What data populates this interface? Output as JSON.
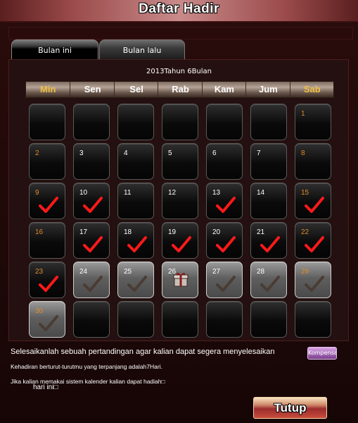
{
  "window": {
    "title": "Daftar Hadir"
  },
  "tabs": [
    {
      "label": "Bulan ini",
      "active": true
    },
    {
      "label": "Bulan lalu",
      "active": false
    }
  ],
  "calendar": {
    "month_label": "2013Tahun 6Bulan",
    "weekdays": [
      "Min",
      "Sen",
      "Sel",
      "Rab",
      "Kam",
      "Jum",
      "Sab"
    ],
    "weekday_colors": [
      "#f0c040",
      "#ffffff",
      "#ffffff",
      "#ffffff",
      "#ffffff",
      "#ffffff",
      "#f0c040"
    ],
    "weekend_number_color": "#e08a2a",
    "check_colors": {
      "attended": "#ff1a1a",
      "pending": "#4a3c34"
    },
    "rows": [
      [
        null,
        null,
        null,
        null,
        null,
        null,
        {
          "day": "1",
          "state": "empty"
        }
      ],
      [
        {
          "day": "2",
          "state": "empty"
        },
        {
          "day": "3",
          "state": "empty"
        },
        {
          "day": "4",
          "state": "empty"
        },
        {
          "day": "5",
          "state": "empty"
        },
        {
          "day": "6",
          "state": "empty"
        },
        {
          "day": "7",
          "state": "empty"
        },
        {
          "day": "8",
          "state": "empty"
        }
      ],
      [
        {
          "day": "9",
          "state": "checked"
        },
        {
          "day": "10",
          "state": "checked"
        },
        {
          "day": "11",
          "state": "empty"
        },
        {
          "day": "12",
          "state": "empty"
        },
        {
          "day": "13",
          "state": "checked"
        },
        {
          "day": "14",
          "state": "empty"
        },
        {
          "day": "15",
          "state": "checked"
        }
      ],
      [
        {
          "day": "16",
          "state": "empty"
        },
        {
          "day": "17",
          "state": "checked"
        },
        {
          "day": "18",
          "state": "checked"
        },
        {
          "day": "19",
          "state": "checked"
        },
        {
          "day": "20",
          "state": "checked"
        },
        {
          "day": "21",
          "state": "checked"
        },
        {
          "day": "22",
          "state": "checked"
        }
      ],
      [
        {
          "day": "23",
          "state": "checked"
        },
        {
          "day": "24",
          "state": "pending"
        },
        {
          "day": "25",
          "state": "pending"
        },
        {
          "day": "26",
          "state": "gift"
        },
        {
          "day": "27",
          "state": "pending"
        },
        {
          "day": "28",
          "state": "pending"
        },
        {
          "day": "29",
          "state": "pending"
        }
      ],
      [
        {
          "day": "30",
          "state": "pending"
        },
        null,
        null,
        null,
        null,
        null,
        null
      ]
    ]
  },
  "info": {
    "line1": "Selesaikanlah sebuah pertandingan agar kalian dapat segera menyelesaikan",
    "line2": "Kehadiran berturut-turutmu yang terpanjang adalah7Hari.",
    "line3": "Jika kalian memakai sistem kalender kalian dapat hadiah□",
    "line4": "hari ini□"
  },
  "kompensasi_label": "Kompensasi",
  "close_label": "Tutup"
}
